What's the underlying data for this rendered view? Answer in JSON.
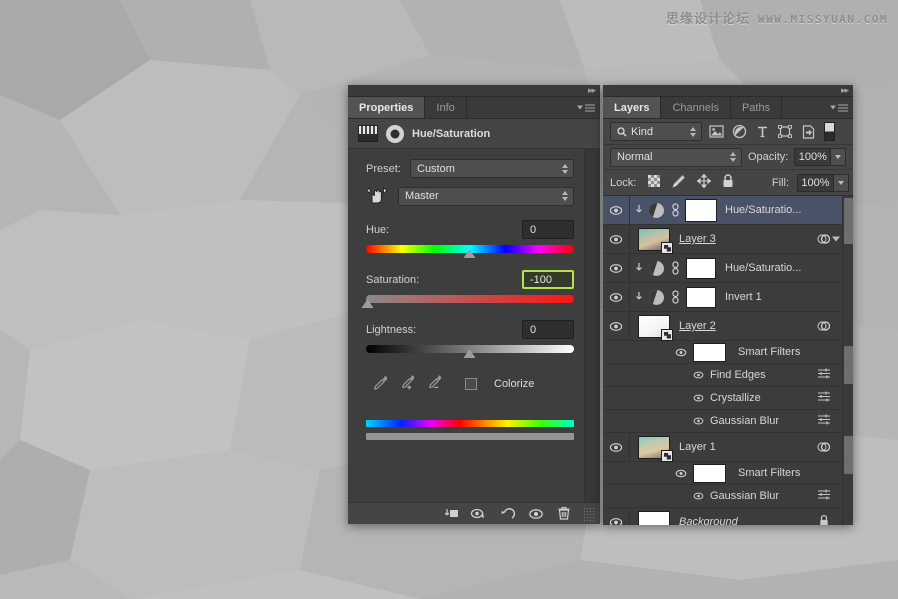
{
  "watermark": {
    "cn": "思缘设计论坛",
    "en": "WWW.MISSYUAN.COM"
  },
  "properties_panel": {
    "tabs": [
      {
        "label": "Properties",
        "active": true
      },
      {
        "label": "Info",
        "active": false
      }
    ],
    "adjustment_title": "Hue/Saturation",
    "preset_label": "Preset:",
    "preset_value": "Custom",
    "channel_value": "Master",
    "sliders": [
      {
        "label": "Hue:",
        "value": "0",
        "thumb_pct": 50,
        "focused": false,
        "track": "hue"
      },
      {
        "label": "Saturation:",
        "value": "-100",
        "thumb_pct": 0,
        "focused": true,
        "track": "sat"
      },
      {
        "label": "Lightness:",
        "value": "0",
        "thumb_pct": 50,
        "focused": false,
        "track": "light"
      }
    ],
    "colorize_label": "Colorize",
    "colorize_checked": false,
    "eyedroppers": [
      "eyedropper-icon",
      "eyedropper-plus-icon",
      "eyedropper-minus-icon"
    ],
    "footer_buttons": [
      "clip-to-layer-icon",
      "preview-previous-icon",
      "reset-icon",
      "toggle-visibility-icon",
      "delete-icon"
    ],
    "focus_border_color": "#b5e14c"
  },
  "layers_panel": {
    "tabs": [
      {
        "label": "Layers",
        "active": true
      },
      {
        "label": "Channels",
        "active": false
      },
      {
        "label": "Paths",
        "active": false
      }
    ],
    "filter_kind": "Kind",
    "filter_icons": [
      "pixel-filter-icon",
      "adjustment-filter-icon",
      "type-filter-icon",
      "shape-filter-icon",
      "smart-object-filter-icon"
    ],
    "blend_mode": "Normal",
    "opacity_label": "Opacity:",
    "opacity_value": "100%",
    "lock_label": "Lock:",
    "lock_icons": [
      "lock-transparent-icon",
      "lock-image-icon",
      "lock-position-icon",
      "lock-all-icon"
    ],
    "fill_label": "Fill:",
    "fill_value": "100%",
    "rows": [
      {
        "type": "adjustment",
        "name": "Hue/Saturatio...",
        "selected": true,
        "visible": true,
        "clipped": true
      },
      {
        "type": "smart",
        "name": "Layer 3",
        "selected": false,
        "visible": true,
        "underline": true,
        "thumb": "sunset",
        "fx": true,
        "caret": true
      },
      {
        "type": "adjustment",
        "name": "Hue/Saturatio...",
        "selected": false,
        "visible": true,
        "clipped": true
      },
      {
        "type": "adjustment",
        "name": "Invert 1",
        "selected": false,
        "visible": true,
        "clipped": true
      },
      {
        "type": "smart",
        "name": "Layer 2",
        "selected": false,
        "visible": true,
        "underline": true,
        "thumb": "white",
        "fx": true
      },
      {
        "type": "smart-filters",
        "name": "Smart Filters",
        "visible": true
      },
      {
        "type": "filter",
        "name": "Find Edges",
        "visible": true
      },
      {
        "type": "filter",
        "name": "Crystallize",
        "visible": true
      },
      {
        "type": "filter",
        "name": "Gaussian Blur",
        "visible": true
      },
      {
        "type": "smart",
        "name": "Layer 1",
        "selected": false,
        "visible": true,
        "underline": false,
        "thumb": "sunset2",
        "fx": true
      },
      {
        "type": "smart-filters",
        "name": "Smart Filters",
        "visible": true
      },
      {
        "type": "filter",
        "name": "Gaussian Blur",
        "visible": true
      },
      {
        "type": "background",
        "name": "Background",
        "visible": true,
        "locked": true
      }
    ]
  }
}
